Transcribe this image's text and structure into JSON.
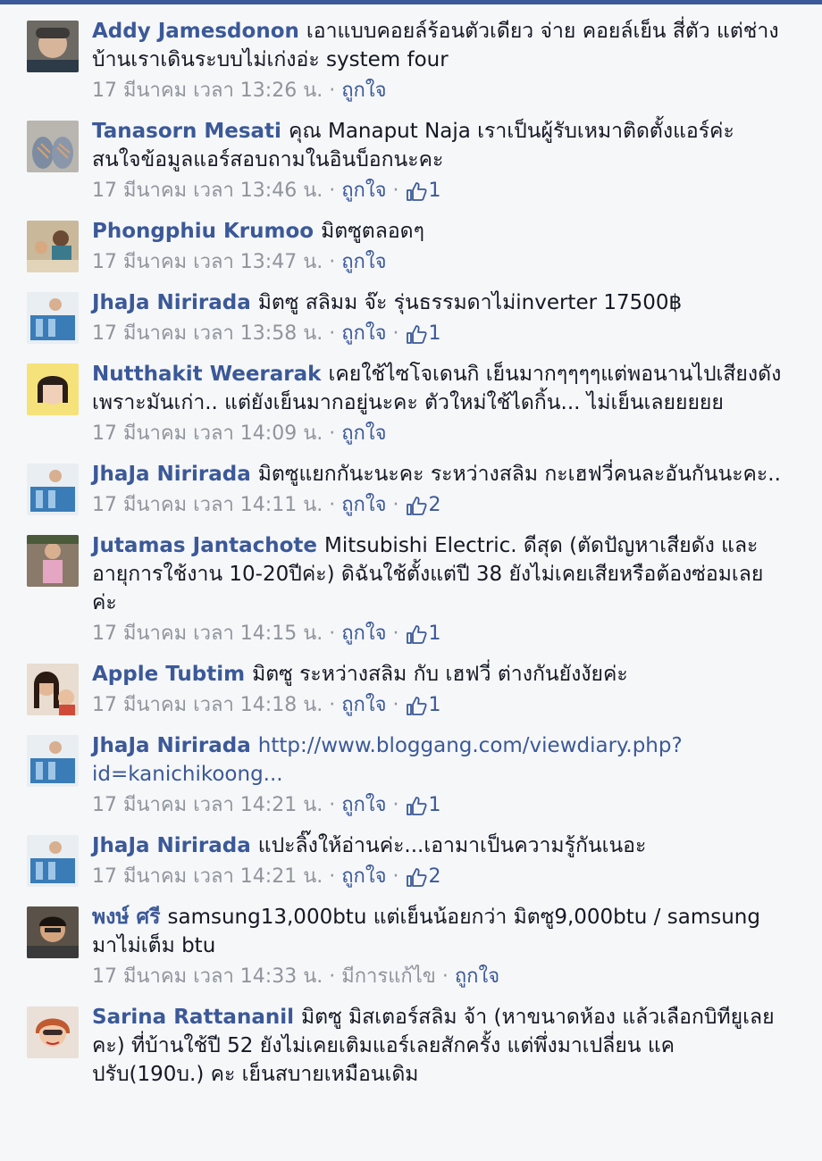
{
  "comments": [
    {
      "name": "Addy Jamesdonon",
      "text": "เอาแบบคอยล์ร้อนตัวเดียว จ่าย คอยล์เย็น สี่ตัว แต่ช่างบ้านเราเดินระบบไม่เก่งอ่ะ system four",
      "time": "17 มีนาคม เวลา 13:26 น.",
      "like": "ถูกใจ",
      "likes": ""
    },
    {
      "name": "Tanasorn Mesati",
      "text": "คุณ Manaput Naja เราเป็นผู้รับเหมาติดตั้งแอร์ค่ะ สนใจข้อมูลแอร์สอบถามในอินบ็อกนะคะ",
      "time": "17 มีนาคม เวลา 13:46 น.",
      "like": "ถูกใจ",
      "likes": "1"
    },
    {
      "name": "Phongphiu Krumoo",
      "text": "มิตซูตลอดๆ",
      "time": "17 มีนาคม เวลา 13:47 น.",
      "like": "ถูกใจ",
      "likes": ""
    },
    {
      "name": "JhaJa Nirirada",
      "text": "มิตซู สลิมม จ๊ะ รุ่นธรรมดาไม่inverter 17500฿",
      "time": "17 มีนาคม เวลา 13:58 น.",
      "like": "ถูกใจ",
      "likes": "1"
    },
    {
      "name": "Nutthakit Weerarak",
      "text": "เคยใช้ไซโจเดนกิ เย็นมากๆๆๆๆแต่พอนานไปเสียงดังเพราะมันเก่า.. แต่ยังเย็นมากอยู่นะคะ ตัวใหม่ใช้ไดกิ้น... ไม่เย็นเลยยยยย",
      "time": "17 มีนาคม เวลา 14:09 น.",
      "like": "ถูกใจ",
      "likes": ""
    },
    {
      "name": "JhaJa Nirirada",
      "text": "มิตซูแยกกันะนะคะ ระหว่างสลิม กะเฮฟวี่คนละอันกันนะคะ..",
      "time": "17 มีนาคม เวลา 14:11 น.",
      "like": "ถูกใจ",
      "likes": "2"
    },
    {
      "name": "Jutamas Jantachote",
      "text": "Mitsubishi Electric. ดีสุด (ตัดปัญหาเสียดัง และ อายุการใช้งาน 10-20ปีค่ะ) ดิฉันใช้ตั้งแต่ปี 38 ยังไม่เคยเสียหรือต้องซ่อมเลยค่ะ",
      "time": "17 มีนาคม เวลา 14:15 น.",
      "like": "ถูกใจ",
      "likes": "1"
    },
    {
      "name": "Apple Tubtim",
      "text": "มิตซู ระหว่างสลิม กับ เฮฟวี่ ต่างกันยังงัยค่ะ",
      "time": "17 มีนาคม เวลา 14:18 น.",
      "like": "ถูกใจ",
      "likes": "1"
    },
    {
      "name": "JhaJa Nirirada",
      "text": "",
      "link": "http://www.bloggang.com/viewdiary.php?id=kanichikoong...",
      "time": "17 มีนาคม เวลา 14:21 น.",
      "like": "ถูกใจ",
      "likes": "1"
    },
    {
      "name": "JhaJa Nirirada",
      "text": "แปะลิ๊งให้อ่านค่ะ...เอามาเป็นความรู้กันเนอะ",
      "time": "17 มีนาคม เวลา 14:21 น.",
      "like": "ถูกใจ",
      "likes": "2"
    },
    {
      "name": "พงษ์ ศรี",
      "text": "samsung13,000btu แต่เย็นน้อยกว่า มิตซู9,000btu / samsung มาไม่เต็ม btu",
      "time": "17 มีนาคม เวลา 14:33 น.",
      "edited": "มีการแก้ไข",
      "like": "ถูกใจ",
      "likes": ""
    },
    {
      "name": "Sarina Rattananil",
      "text": "มิตซู มิสเตอร์สลิม จ้า (หาขนาดห้อง แล้วเลือกบิทียูเลยคะ) ที่บ้านใช้ปี 52 ยังไม่เคยเติมแอร์เลยสักครั้ง แต่พึ่งมาเปลี่ยน แคปรับ(190บ.) คะ เย็นสบายเหมือนเดิม",
      "time": "",
      "like": "",
      "likes": ""
    }
  ],
  "colors": {
    "name": "#3b5998",
    "meta": "#90949c",
    "text": "#141823"
  },
  "icons": {
    "like": "thumbs-up-icon"
  }
}
